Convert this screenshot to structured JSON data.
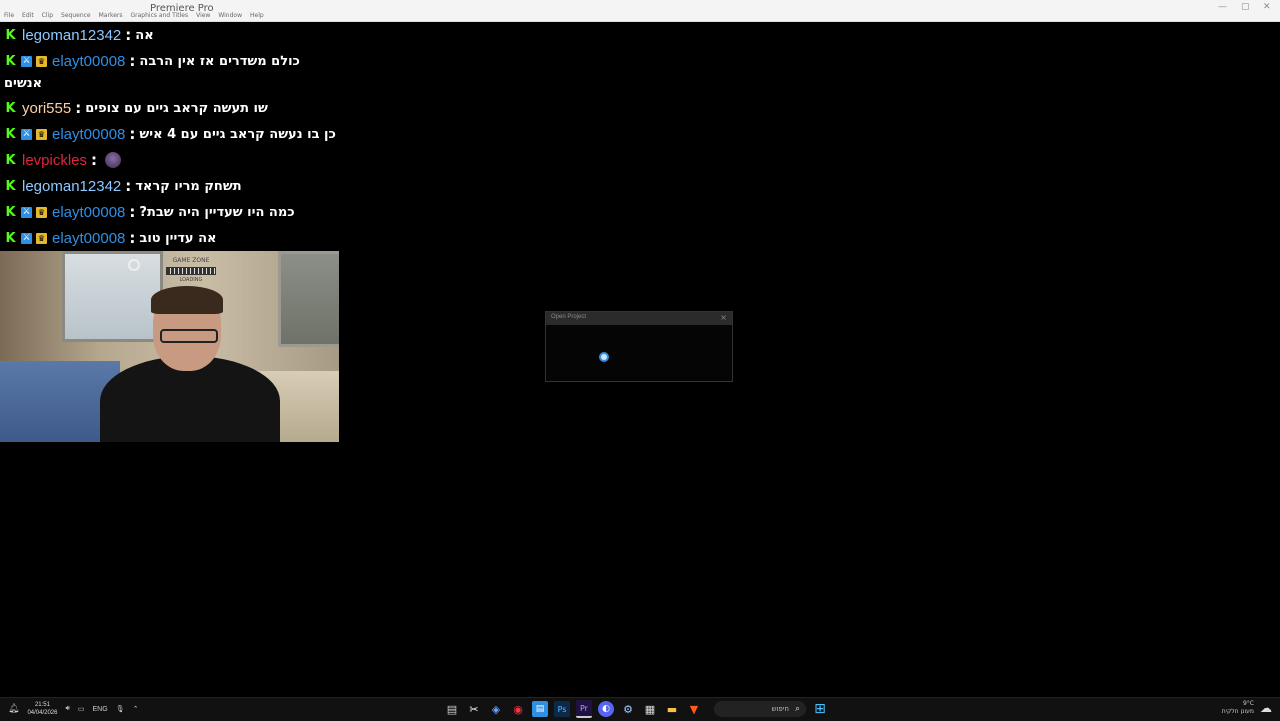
{
  "titlebar": {
    "window_title": "Premiere Pro",
    "menu": [
      "File",
      "Edit",
      "Clip",
      "Sequence",
      "Markers",
      "Graphics and Titles",
      "View",
      "Window",
      "Help"
    ]
  },
  "chat": {
    "messages": [
      {
        "user": "legoman12342",
        "user_color": "#8ec8ff",
        "badges": [
          "kick"
        ],
        "text": "אה"
      },
      {
        "user": "elayt00008",
        "user_color": "#2f8fe3",
        "badges": [
          "kick",
          "mod",
          "vip"
        ],
        "text": "כולם משדרים אז אין הרבה",
        "continuation": "אנשים"
      },
      {
        "user": "yori555",
        "user_color": "#ffd0a8",
        "badges": [
          "kick"
        ],
        "text": "שו תעשה קראב גיים עם צופים"
      },
      {
        "user": "elayt00008",
        "user_color": "#2f8fe3",
        "badges": [
          "kick",
          "mod",
          "vip"
        ],
        "text": "כן בו נעשה קראב גיים עם 4 איש"
      },
      {
        "user": "levpickles",
        "user_color": "#e0243c",
        "badges": [
          "kick"
        ],
        "text": "",
        "emote": "emote-icon"
      },
      {
        "user": "legoman12342",
        "user_color": "#8ec8ff",
        "badges": [
          "kick"
        ],
        "text": "תשחק מריו קראד"
      },
      {
        "user": "elayt00008",
        "user_color": "#2f8fe3",
        "badges": [
          "kick",
          "mod",
          "vip"
        ],
        "text": "כמה היו שעדיין היה שבת?"
      },
      {
        "user": "elayt00008",
        "user_color": "#2f8fe3",
        "badges": [
          "kick",
          "mod",
          "vip"
        ],
        "text": "אה עדיין טוב"
      }
    ],
    "separator": ":"
  },
  "webcam": {
    "poster_title": "GAME ZONE",
    "poster_sub": "LOADING"
  },
  "dialog": {
    "title": "Open Project",
    "close": "×"
  },
  "taskbar": {
    "time": "21:51",
    "date": "04/04/2026",
    "lang": "ENG",
    "search_placeholder": "חיפוש",
    "weather_temp": "9°C",
    "weather_desc": "מעונן חלקית",
    "icons": [
      "terminal-icon",
      "capcut-icon",
      "obs-icon",
      "chrome-icon",
      "notepad-icon",
      "photoshop-icon",
      "premiere-icon",
      "discord-icon",
      "steam-icon",
      "calendar-icon",
      "folder-icon",
      "brave-icon"
    ]
  },
  "colors": {
    "kick_green": "#53fc18",
    "mod_blue": "#2f8fe3",
    "vip_gold": "#e5b82e"
  }
}
